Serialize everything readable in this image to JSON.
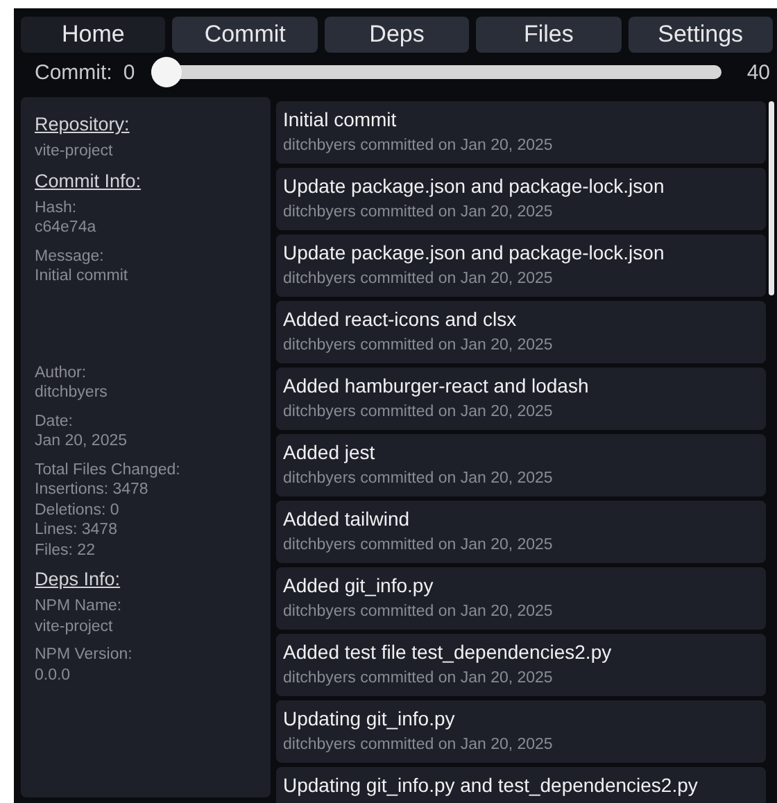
{
  "tabs": [
    {
      "label": "Home",
      "selected": true
    },
    {
      "label": "Commit",
      "selected": false
    },
    {
      "label": "Deps",
      "selected": false
    },
    {
      "label": "Files",
      "selected": false
    },
    {
      "label": "Settings",
      "selected": false
    }
  ],
  "slider": {
    "label": "Commit:",
    "min": "0",
    "max": "40",
    "level": 0
  },
  "sidebar": {
    "sections": [
      {
        "heading": "Repository:",
        "fields": [
          {
            "kind": "plain",
            "values": [
              "vite-project"
            ]
          }
        ]
      },
      {
        "heading": "Commit Info:",
        "fields": [
          {
            "kind": "pair",
            "label": "Hash:",
            "values": [
              "c64e74a"
            ]
          },
          {
            "kind": "message",
            "label": "Message:",
            "values": [
              "Initial commit"
            ]
          },
          {
            "kind": "pair",
            "label": "Author:",
            "values": [
              "ditchbyers"
            ]
          },
          {
            "kind": "pair",
            "label": "Date:",
            "values": [
              "Jan 20, 2025"
            ]
          },
          {
            "kind": "pair",
            "label": "Total Files Changed:",
            "values": [
              "Insertions: 3478",
              "Deletions: 0",
              "Lines: 3478",
              "Files: 22"
            ]
          }
        ]
      },
      {
        "heading": "Deps Info:",
        "fields": [
          {
            "kind": "pair",
            "label": "NPM Name:",
            "values": [
              "vite-project"
            ]
          },
          {
            "kind": "pair",
            "label": "NPM Version:",
            "values": [
              "0.0.0"
            ]
          }
        ]
      }
    ]
  },
  "commits": [
    {
      "message": "Initial commit",
      "meta": "ditchbyers committed on Jan 20, 2025"
    },
    {
      "message": "Update package.json and package-lock.json",
      "meta": "ditchbyers committed on Jan 20, 2025"
    },
    {
      "message": "Update package.json and package-lock.json",
      "meta": "ditchbyers committed on Jan 20, 2025"
    },
    {
      "message": "Added react-icons and clsx",
      "meta": "ditchbyers committed on Jan 20, 2025"
    },
    {
      "message": "Added hamburger-react and lodash",
      "meta": "ditchbyers committed on Jan 20, 2025"
    },
    {
      "message": "Added jest",
      "meta": "ditchbyers committed on Jan 20, 2025"
    },
    {
      "message": "Added tailwind",
      "meta": "ditchbyers committed on Jan 20, 2025"
    },
    {
      "message": "Added git_info.py",
      "meta": "ditchbyers committed on Jan 20, 2025"
    },
    {
      "message": "Added test file test_dependencies2.py",
      "meta": "ditchbyers committed on Jan 20, 2025"
    },
    {
      "message": "Updating git_info.py",
      "meta": "ditchbyers committed on Jan 20, 2025"
    },
    {
      "message": "Updating git_info.py and test_dependencies2.py"
    }
  ]
}
